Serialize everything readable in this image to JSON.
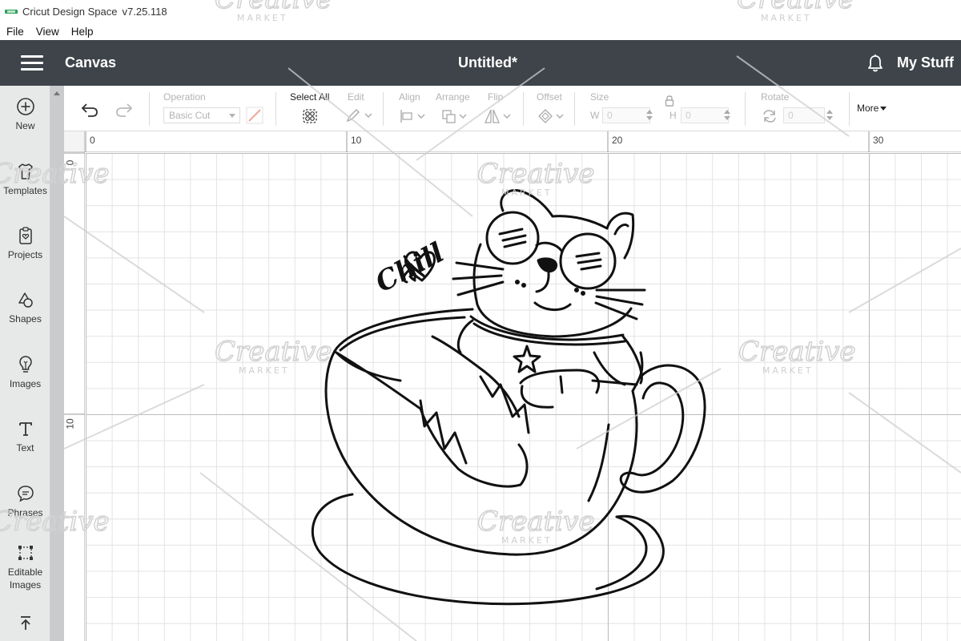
{
  "window": {
    "app_name": "Cricut Design Space",
    "version": "v7.25.118"
  },
  "menu": [
    "File",
    "View",
    "Help"
  ],
  "header": {
    "left_label": "Canvas",
    "document_title": "Untitled*",
    "right_label": "My Stuff"
  },
  "sidebar": {
    "items": [
      {
        "label": "New",
        "icon": "plus-circle-icon"
      },
      {
        "label": "Templates",
        "icon": "shirt-icon"
      },
      {
        "label": "Projects",
        "icon": "clipboard-icon"
      },
      {
        "label": "Shapes",
        "icon": "shapes-icon"
      },
      {
        "label": "Images",
        "icon": "lightbulb-icon"
      },
      {
        "label": "Text",
        "icon": "text-icon"
      },
      {
        "label": "Phrases",
        "icon": "speech-bubble-icon"
      },
      {
        "label": "Editable",
        "label2": "Images",
        "icon": "edit-image-icon"
      }
    ]
  },
  "toolbar": {
    "operation_label": "Operation",
    "operation_value": "Basic Cut",
    "select_all_label": "Select All",
    "edit_label": "Edit",
    "align_label": "Align",
    "arrange_label": "Arrange",
    "flip_label": "Flip",
    "offset_label": "Offset",
    "size_label": "Size",
    "width_letter": "W",
    "height_letter": "H",
    "width_value": "0",
    "height_value": "0",
    "rotate_label": "Rotate",
    "rotate_value": "0",
    "more_label": "More"
  },
  "ruler": {
    "top": [
      "0",
      "10",
      "20",
      "30"
    ],
    "left": [
      "0",
      "10"
    ]
  },
  "artwork": {
    "text": "Chill"
  },
  "watermark": {
    "text": "Creative",
    "subtext": "MARKET"
  }
}
